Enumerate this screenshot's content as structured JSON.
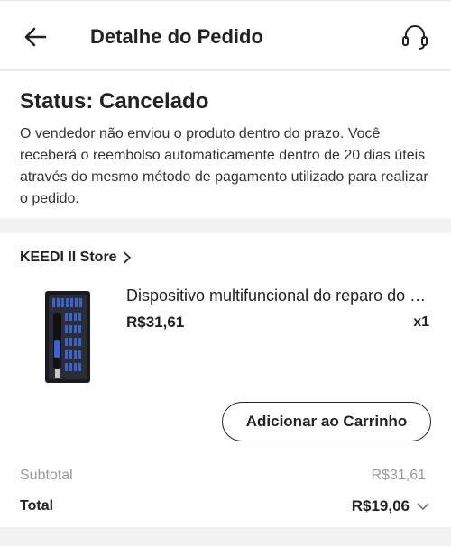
{
  "header": {
    "title": "Detalhe do Pedido",
    "back_icon": "arrow-left-icon",
    "support_icon": "headset-icon"
  },
  "status": {
    "title": "Status: Cancelado",
    "message": "O vendedor não enviou o produto dentro do prazo. Você receberá o reembolso automaticamente dentro de 20 dias úteis através do mesmo método de pagamento utilizado para realizar o pedido."
  },
  "store": {
    "name": "KEEDI II Store",
    "chevron_icon": "chevron-right-icon"
  },
  "product": {
    "name": "Dispositivo multifuncional do reparo do hardware",
    "price": "R$31,61",
    "quantity": "x1",
    "image": "screwdriver-kit-product-image"
  },
  "actions": {
    "add_to_cart": "Adicionar ao Carrinho"
  },
  "summary": {
    "subtotal_label": "Subtotal",
    "subtotal_value": "R$31,61",
    "total_label": "Total",
    "total_value": "R$19,06",
    "expand_icon": "chevron-down-icon"
  },
  "colors": {
    "text": "#222222",
    "muted": "#9a9a9a",
    "background": "#f2f2f2",
    "product_accent": "#2b4fb3"
  }
}
